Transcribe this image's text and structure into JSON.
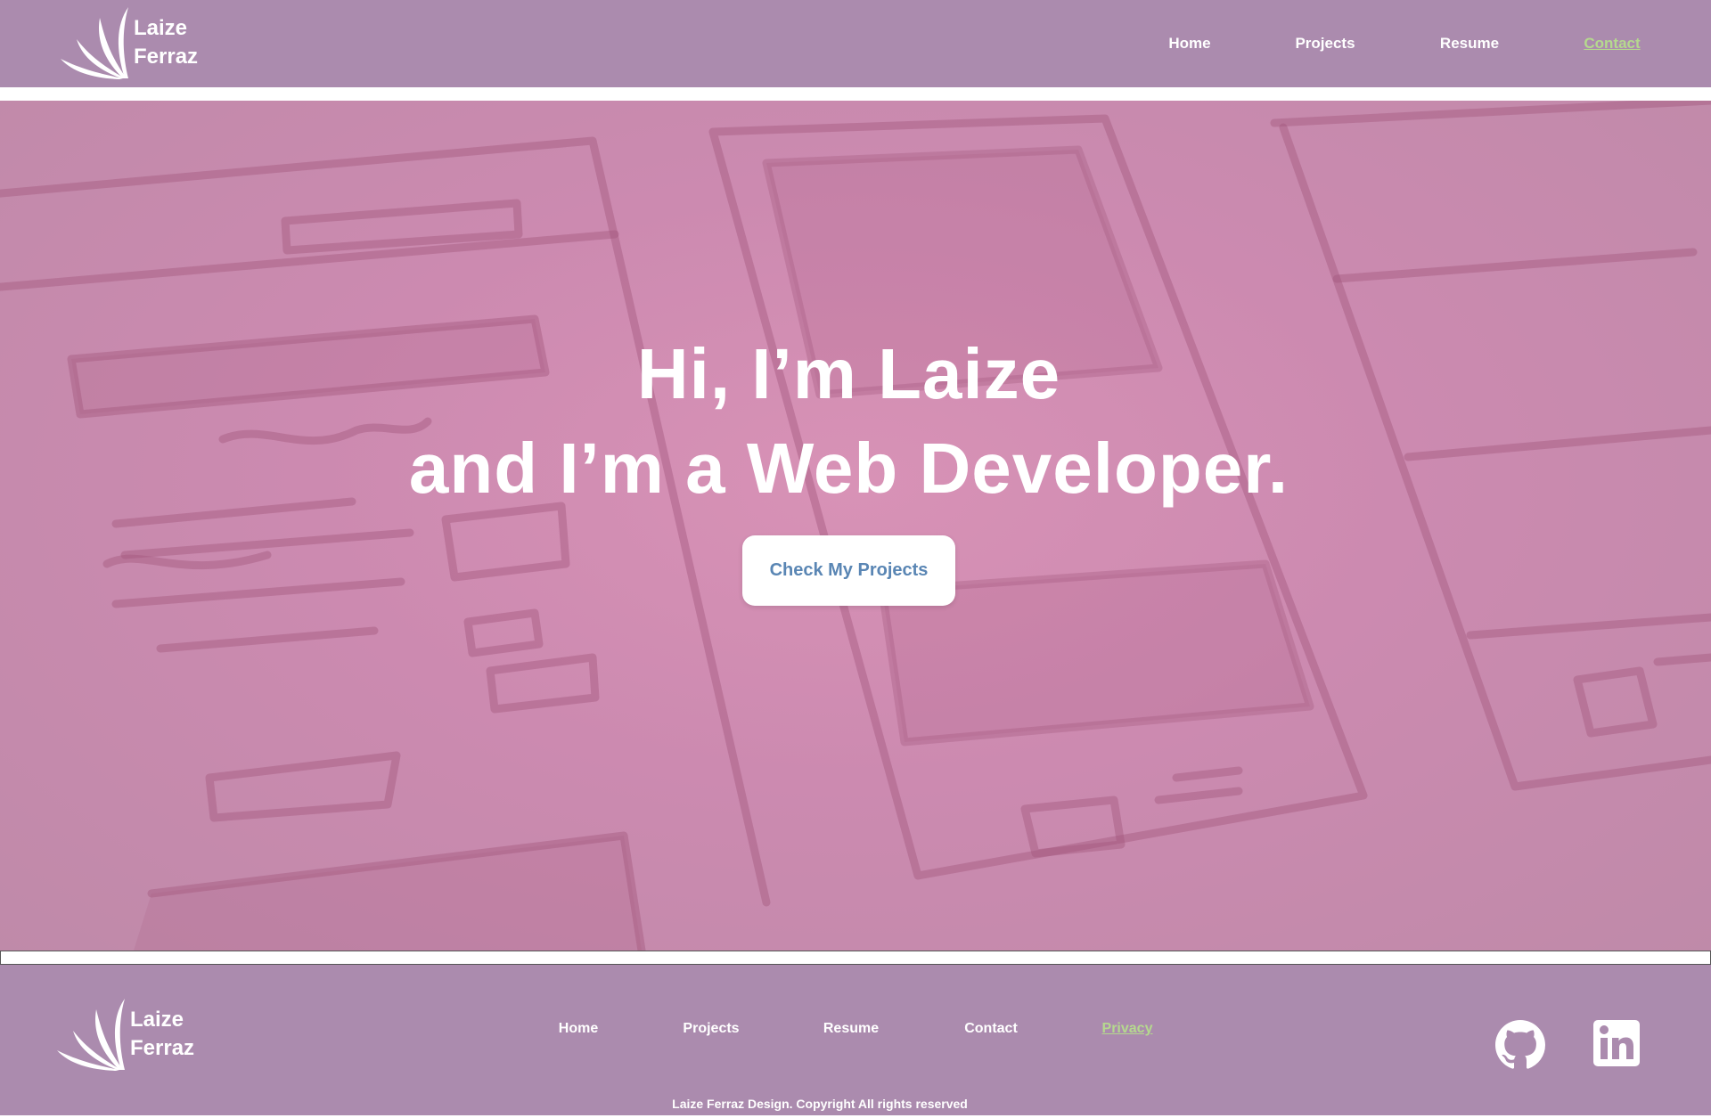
{
  "header": {
    "brand": {
      "line1": "Laize",
      "line2": "Ferraz",
      "logo_icon": "leaf-fan-icon"
    },
    "nav": [
      {
        "label": "Home",
        "active": false
      },
      {
        "label": "Projects",
        "active": false
      },
      {
        "label": "Resume",
        "active": false
      },
      {
        "label": "Contact",
        "active": true
      }
    ]
  },
  "hero": {
    "title_line1": "Hi, I’m Laize",
    "title_line2": "and I’m a Web Developer.",
    "cta_label": "Check My Projects",
    "background": "wireframe-sketch-image"
  },
  "footer": {
    "brand": {
      "line1": "Laize",
      "line2": "Ferraz",
      "logo_icon": "leaf-fan-icon"
    },
    "nav": [
      {
        "label": "Home",
        "active": false
      },
      {
        "label": "Projects",
        "active": false
      },
      {
        "label": "Resume",
        "active": false
      },
      {
        "label": "Contact",
        "active": false
      },
      {
        "label": "Privacy",
        "active": true
      }
    ],
    "social": [
      {
        "icon": "github-icon"
      },
      {
        "icon": "linkedin-icon"
      }
    ],
    "copyright": "Laize Ferraz Design. Copyright All rights reserved"
  },
  "colors": {
    "bar": "#ab8bae",
    "hero_tint": "#d892b6",
    "active_link": "#b5d98e",
    "cta_text": "#5a86b4",
    "text": "#ffffff"
  }
}
